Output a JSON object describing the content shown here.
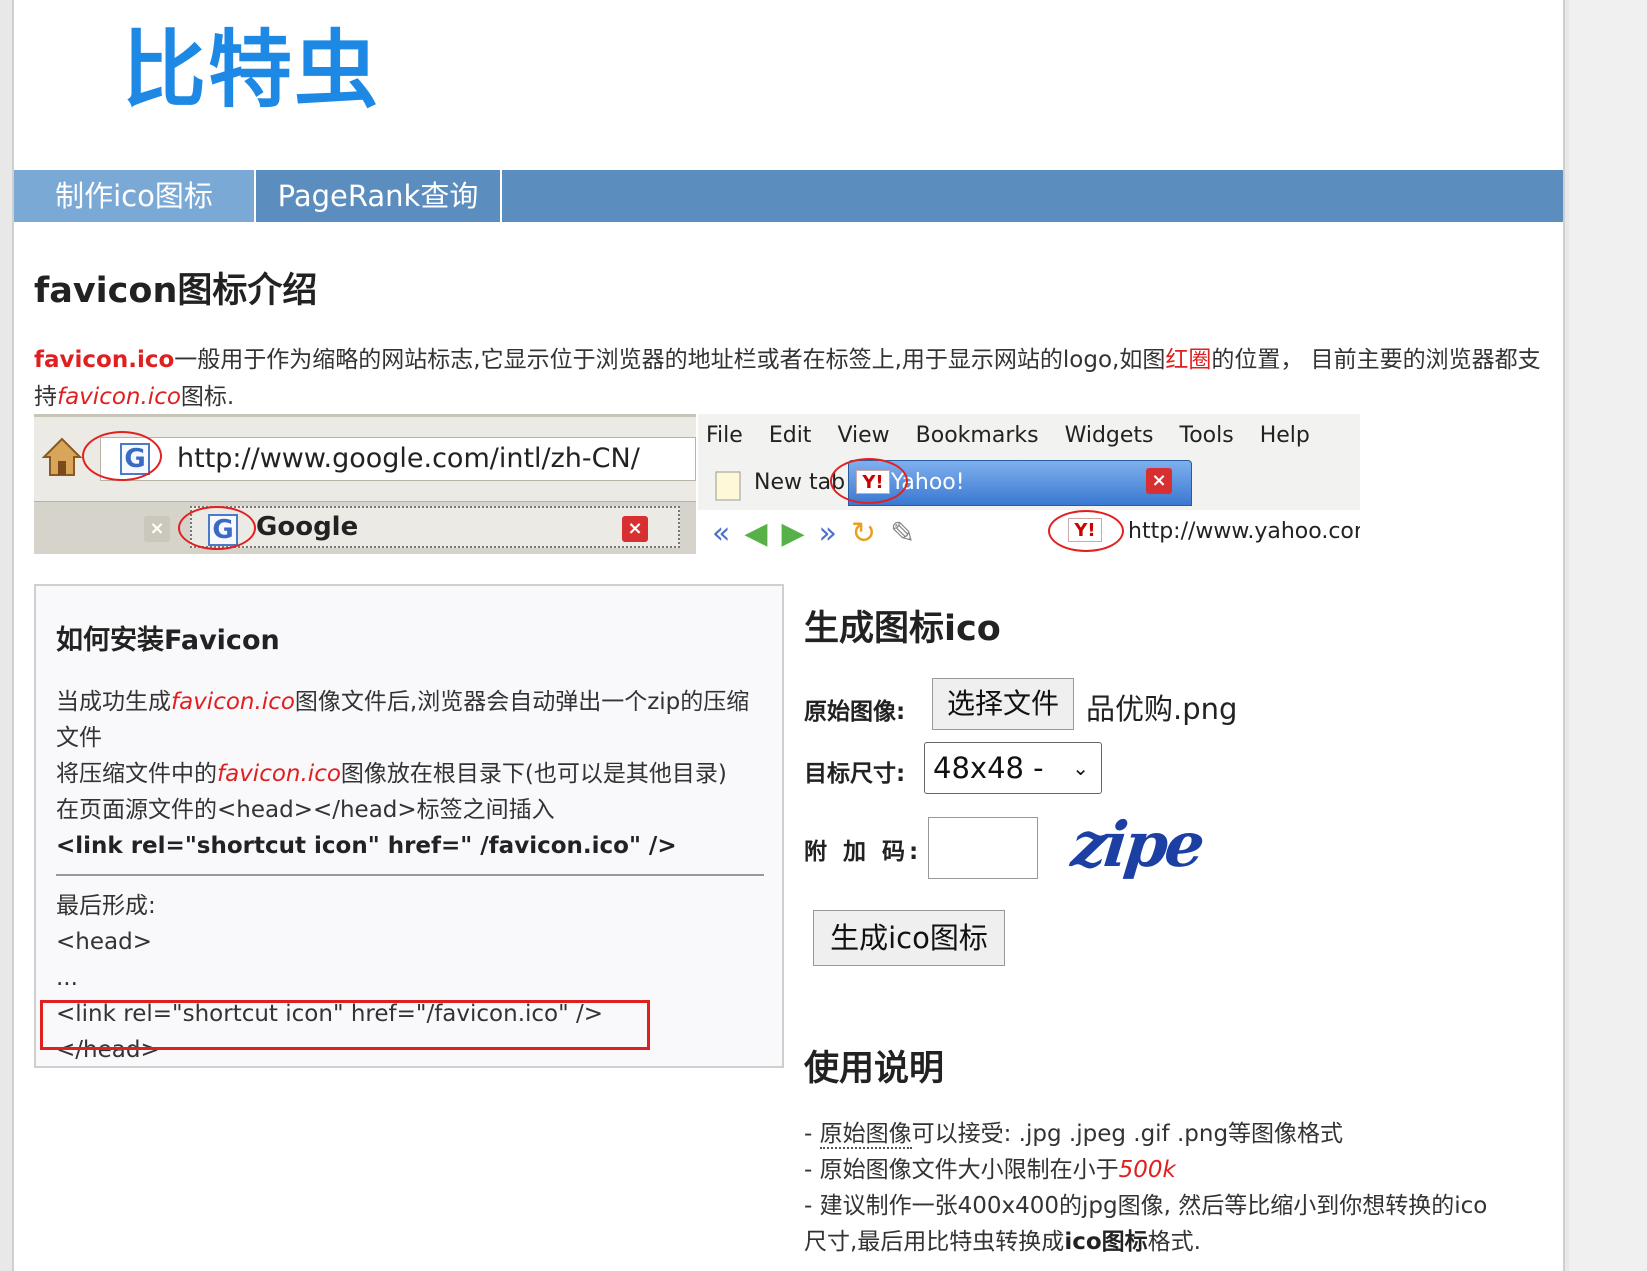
{
  "header": {
    "logo_text": "比特虫"
  },
  "nav": {
    "items": [
      {
        "label": "制作ico图标"
      },
      {
        "label": "PageRank查询"
      }
    ]
  },
  "intro": {
    "title": "favicon图标介绍",
    "p1_strong": "favicon.ico",
    "p1_a": "一般用于作为缩略的网站标志,它显示位于浏览器的地址栏或者在标签上,用于显示网站的logo,如图",
    "p1_red": "红圈",
    "p1_b": "的位置，  目前主要的浏览器都支持",
    "p1_ital": "favicon.ico",
    "p1_c": "图标."
  },
  "illustration": {
    "left_url": "http://www.google.com/intl/zh-CN/",
    "left_tab": "Google",
    "g_letter": "G",
    "menu": [
      "File",
      "Edit",
      "View",
      "Bookmarks",
      "Widgets",
      "Tools",
      "Help"
    ],
    "new_tab": "New tab",
    "yahoo_tab": "Yahoo!",
    "yahoo_badge": "Y!",
    "right_url": "http://www.yahoo.com"
  },
  "install": {
    "title": "如何安装Favicon",
    "l1_a": "当成功生成",
    "l1_ital": "favicon.ico",
    "l1_b": "图像文件后,浏览器会自动弹出一个zip的压缩文件",
    "l2_a": "将压缩文件中的",
    "l2_ital": "favicon.ico",
    "l2_b": "图像放在根目录下(也可以是其他目录)",
    "l3": "在页面源文件的<head></head>标签之间插入",
    "l4": "<link rel=\"shortcut icon\" href=\" /favicon.ico\" />",
    "final_label": "最后形成:",
    "f1": "<head>",
    "f2": "...",
    "f3": "<link rel=\"shortcut icon\" href=\"/favicon.ico\" />",
    "f4": "</head>"
  },
  "generate": {
    "title": "生成图标ico",
    "source_label": "原始图像:",
    "file_button": "选择文件",
    "file_name": "品优购.png",
    "size_label": "目标尺寸:",
    "size_value": "48x48 -",
    "captcha_label": "附 加 码:",
    "captcha_text": "zipe",
    "submit": "生成ico图标"
  },
  "usage": {
    "title": "使用说明",
    "l1_a": "- ",
    "l1_u": "原始图像",
    "l1_b": "可以接受: .jpg .jpeg .gif .png等图像格式",
    "l2_a": "- 原始图像文件大小限制在小于",
    "l2_red": "500k",
    "l3_a": "- 建议制作一张400x400的jpg图像, 然后等比缩小到你想转换的ico尺寸,最后用比特虫转换成",
    "l3_b": "ico图标",
    "l3_c": "格式."
  },
  "colors": {
    "brand": "#1e88e5",
    "nav_bg": "#5b8dbe",
    "nav_active": "#7aa9d6",
    "accent_red": "#e02020"
  }
}
